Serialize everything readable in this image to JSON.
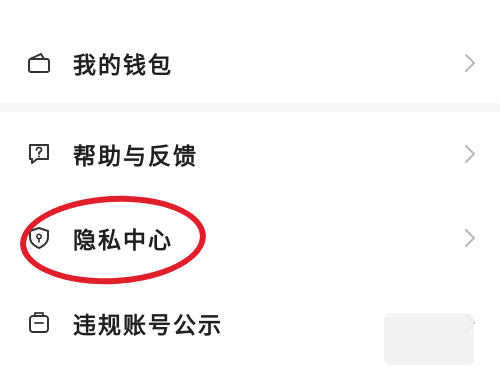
{
  "menu": {
    "items": [
      {
        "label": "我的钱包",
        "icon": "wallet-icon"
      },
      {
        "label": "帮助与反馈",
        "icon": "help-feedback-icon"
      },
      {
        "label": "隐私中心",
        "icon": "privacy-shield-icon"
      },
      {
        "label": "违规账号公示",
        "icon": "violation-notice-icon"
      }
    ]
  },
  "colors": {
    "highlight": "#e01f2b",
    "text": "#1f1f1f",
    "icon": "#333333",
    "chevron": "#b8b8b8",
    "divider_bg": "#f6f6f6"
  }
}
